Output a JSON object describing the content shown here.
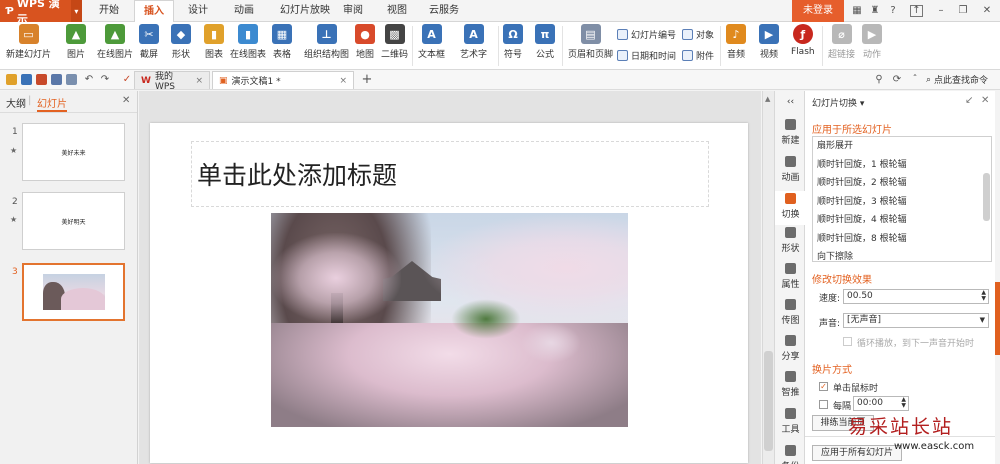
{
  "app": {
    "name": "WPS 演示",
    "login_label": "未登录"
  },
  "menu_tabs": [
    "开始",
    "插入",
    "设计",
    "动画",
    "幻灯片放映",
    "审阅",
    "视图",
    "云服务"
  ],
  "ribbon": {
    "buttons": [
      {
        "label": "新建幻灯片",
        "icon": "new-slide-icon",
        "color": "#d8822b"
      },
      {
        "label": "图片",
        "icon": "picture-icon",
        "color": "#4d9a3a"
      },
      {
        "label": "在线图片",
        "icon": "online-picture-icon",
        "color": "#4d9a3a"
      },
      {
        "label": "截屏",
        "icon": "screenshot-icon",
        "color": "#3a72b7"
      },
      {
        "label": "形状",
        "icon": "shape-icon",
        "color": "#3a72b7"
      },
      {
        "label": "图表",
        "icon": "chart-icon",
        "color": "#e0a12b"
      },
      {
        "label": "在线图表",
        "icon": "online-chart-icon",
        "color": "#3c8ad0"
      },
      {
        "label": "表格",
        "icon": "table-icon",
        "color": "#3a72b7"
      },
      {
        "label": "组织结构图",
        "icon": "org-chart-icon",
        "color": "#3a72b7"
      },
      {
        "label": "地图",
        "icon": "map-icon",
        "color": "#d84a2b"
      },
      {
        "label": "二维码",
        "icon": "qrcode-icon",
        "color": "#444444"
      },
      {
        "label": "文本框",
        "icon": "textbox-icon",
        "color": "#3a72b7"
      },
      {
        "label": "艺术字",
        "icon": "wordart-icon",
        "color": "#3a72b7"
      },
      {
        "label": "符号",
        "icon": "omega-icon",
        "color": "#3a72b7"
      },
      {
        "label": "公式",
        "icon": "pi-icon",
        "color": "#3a72b7"
      },
      {
        "label": "页眉和页脚",
        "icon": "header-footer-icon",
        "color": "#7f8ea6"
      }
    ],
    "small_buttons": [
      "幻灯片编号",
      "日期和时间",
      "对象",
      "附件"
    ],
    "media_buttons": [
      {
        "label": "音频",
        "icon": "audio-icon",
        "color": "#e08a1e"
      },
      {
        "label": "视频",
        "icon": "video-icon",
        "color": "#3a72b7"
      },
      {
        "label": "Flash",
        "icon": "flash-icon",
        "color": "#c8281e"
      },
      {
        "label": "超链接",
        "icon": "hyperlink-icon",
        "color": "#b8b8b8"
      },
      {
        "label": "动作",
        "icon": "action-icon",
        "color": "#b8b8b8"
      }
    ]
  },
  "quickbar": {
    "tabs": [
      {
        "label": "我的WPS",
        "icon": "wps-logo-icon"
      },
      {
        "label": "演示文稿1 *",
        "icon": "presentation-doc-icon"
      }
    ],
    "search_label": "点此查找命令"
  },
  "left_pane": {
    "tabs": [
      "大纲",
      "幻灯片"
    ],
    "slides": [
      {
        "num": "1",
        "text": "美好未来",
        "star": "★"
      },
      {
        "num": "2",
        "text": "美好明天",
        "star": "★"
      },
      {
        "num": "3",
        "text": "",
        "star": ""
      }
    ]
  },
  "slide": {
    "title_placeholder": "单击此处添加标题"
  },
  "sidebar": [
    "新建",
    "动画",
    "切换",
    "形状",
    "属性",
    "传图",
    "分享",
    "智推",
    "工具",
    "备份"
  ],
  "panel": {
    "header": "幻灯片切换 ▾",
    "apply_heading": "应用于所选幻灯片",
    "transitions": [
      "扇形展开",
      "顺时针回旋，1 根轮辐",
      "顺时针回旋，2 根轮辐",
      "顺时针回旋，3 根轮辐",
      "顺时针回旋，4 根轮辐",
      "顺时针回旋，8 根轮辐",
      "向下擦除"
    ],
    "modify_heading": "修改切换效果",
    "speed_label": "速度:",
    "speed_value": "00.50",
    "sound_label": "声音:",
    "sound_value": "[无声音]",
    "loop_label": "循环播放，到下一声音开始时",
    "advance_heading": "换片方式",
    "on_click_label": "单击鼠标时",
    "every_label": "每隔",
    "every_value": "00:00",
    "rehearse_button": "排练当前页",
    "apply_all_button": "应用于所有幻灯片"
  },
  "watermark": {
    "cn": "易采站长站",
    "url": "www.easck.com"
  }
}
